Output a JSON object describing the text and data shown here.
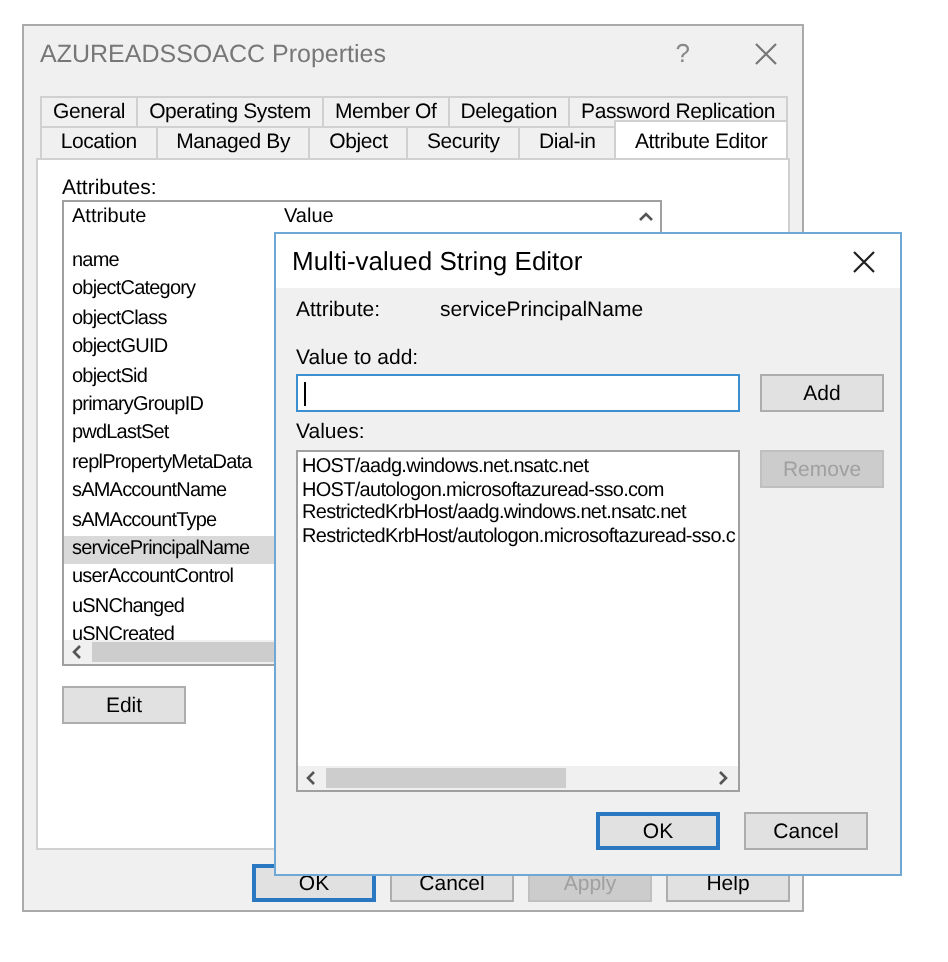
{
  "properties_window": {
    "title": "AZUREADSSOACC Properties",
    "help": "?",
    "tab_rows": [
      [
        {
          "label": "General",
          "selected": false
        },
        {
          "label": "Operating System",
          "selected": false
        },
        {
          "label": "Member Of",
          "selected": false
        },
        {
          "label": "Delegation",
          "selected": false
        },
        {
          "label": "Password Replication",
          "selected": false
        }
      ],
      [
        {
          "label": "Location",
          "selected": false
        },
        {
          "label": "Managed By",
          "selected": false
        },
        {
          "label": "Object",
          "selected": false
        },
        {
          "label": "Security",
          "selected": false
        },
        {
          "label": "Dial-in",
          "selected": false
        },
        {
          "label": "Attribute Editor",
          "selected": true
        }
      ]
    ],
    "attributes_label": "Attributes:",
    "columns": [
      "Attribute",
      "Value"
    ],
    "rows": [
      {
        "attribute": "name",
        "selected": false
      },
      {
        "attribute": "objectCategory",
        "selected": false
      },
      {
        "attribute": "objectClass",
        "selected": false
      },
      {
        "attribute": "objectGUID",
        "selected": false
      },
      {
        "attribute": "objectSid",
        "selected": false
      },
      {
        "attribute": "primaryGroupID",
        "selected": false
      },
      {
        "attribute": "pwdLastSet",
        "selected": false
      },
      {
        "attribute": "replPropertyMetaData",
        "selected": false
      },
      {
        "attribute": "sAMAccountName",
        "selected": false
      },
      {
        "attribute": "sAMAccountType",
        "selected": false
      },
      {
        "attribute": "servicePrincipalName",
        "selected": true
      },
      {
        "attribute": "userAccountControl",
        "selected": false
      },
      {
        "attribute": "uSNChanged",
        "selected": false
      },
      {
        "attribute": "uSNCreated",
        "selected": false
      }
    ],
    "edit_button": "Edit",
    "buttons": [
      {
        "label": "OK",
        "focused": true,
        "disabled": false
      },
      {
        "label": "Cancel",
        "focused": false,
        "disabled": false
      },
      {
        "label": "Apply",
        "focused": false,
        "disabled": true
      },
      {
        "label": "Help",
        "focused": false,
        "disabled": false
      }
    ]
  },
  "dialog": {
    "title": "Multi-valued String Editor",
    "attribute_label": "Attribute:",
    "attribute_value": "servicePrincipalName",
    "value_label": "Value to add:",
    "add_button": {
      "label": "Add",
      "disabled": false
    },
    "values_label": "Values:",
    "values": [
      "HOST/aadg.windows.net.nsatc.net",
      "HOST/autologon.microsoftazuread-sso.com",
      "RestrictedKrbHost/aadg.windows.net.nsatc.net",
      "RestrictedKrbHost/autologon.microsoftazuread-sso.c"
    ],
    "remove_button": {
      "label": "Remove",
      "disabled": true
    },
    "buttons": [
      {
        "label": "OK",
        "focused": true,
        "disabled": false
      },
      {
        "label": "Cancel",
        "focused": false,
        "disabled": false
      }
    ]
  }
}
